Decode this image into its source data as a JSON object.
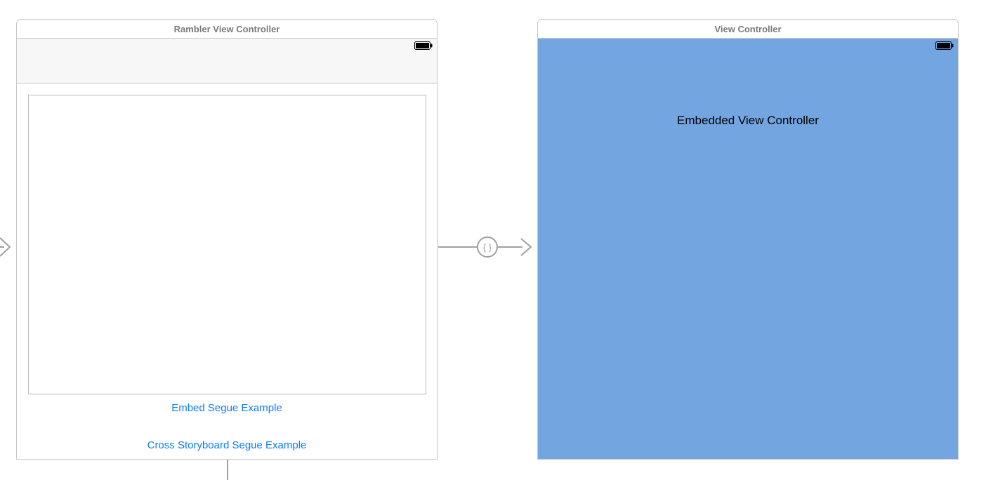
{
  "leftScene": {
    "title": "Rambler View Controller",
    "link1": "Embed Segue Example",
    "link2": "Cross Storyboard Segue Example"
  },
  "rightScene": {
    "title": "View Controller",
    "label": "Embedded View Controller",
    "backgroundColor": "#73a5e0"
  },
  "segue": {
    "icon": "{ }"
  }
}
